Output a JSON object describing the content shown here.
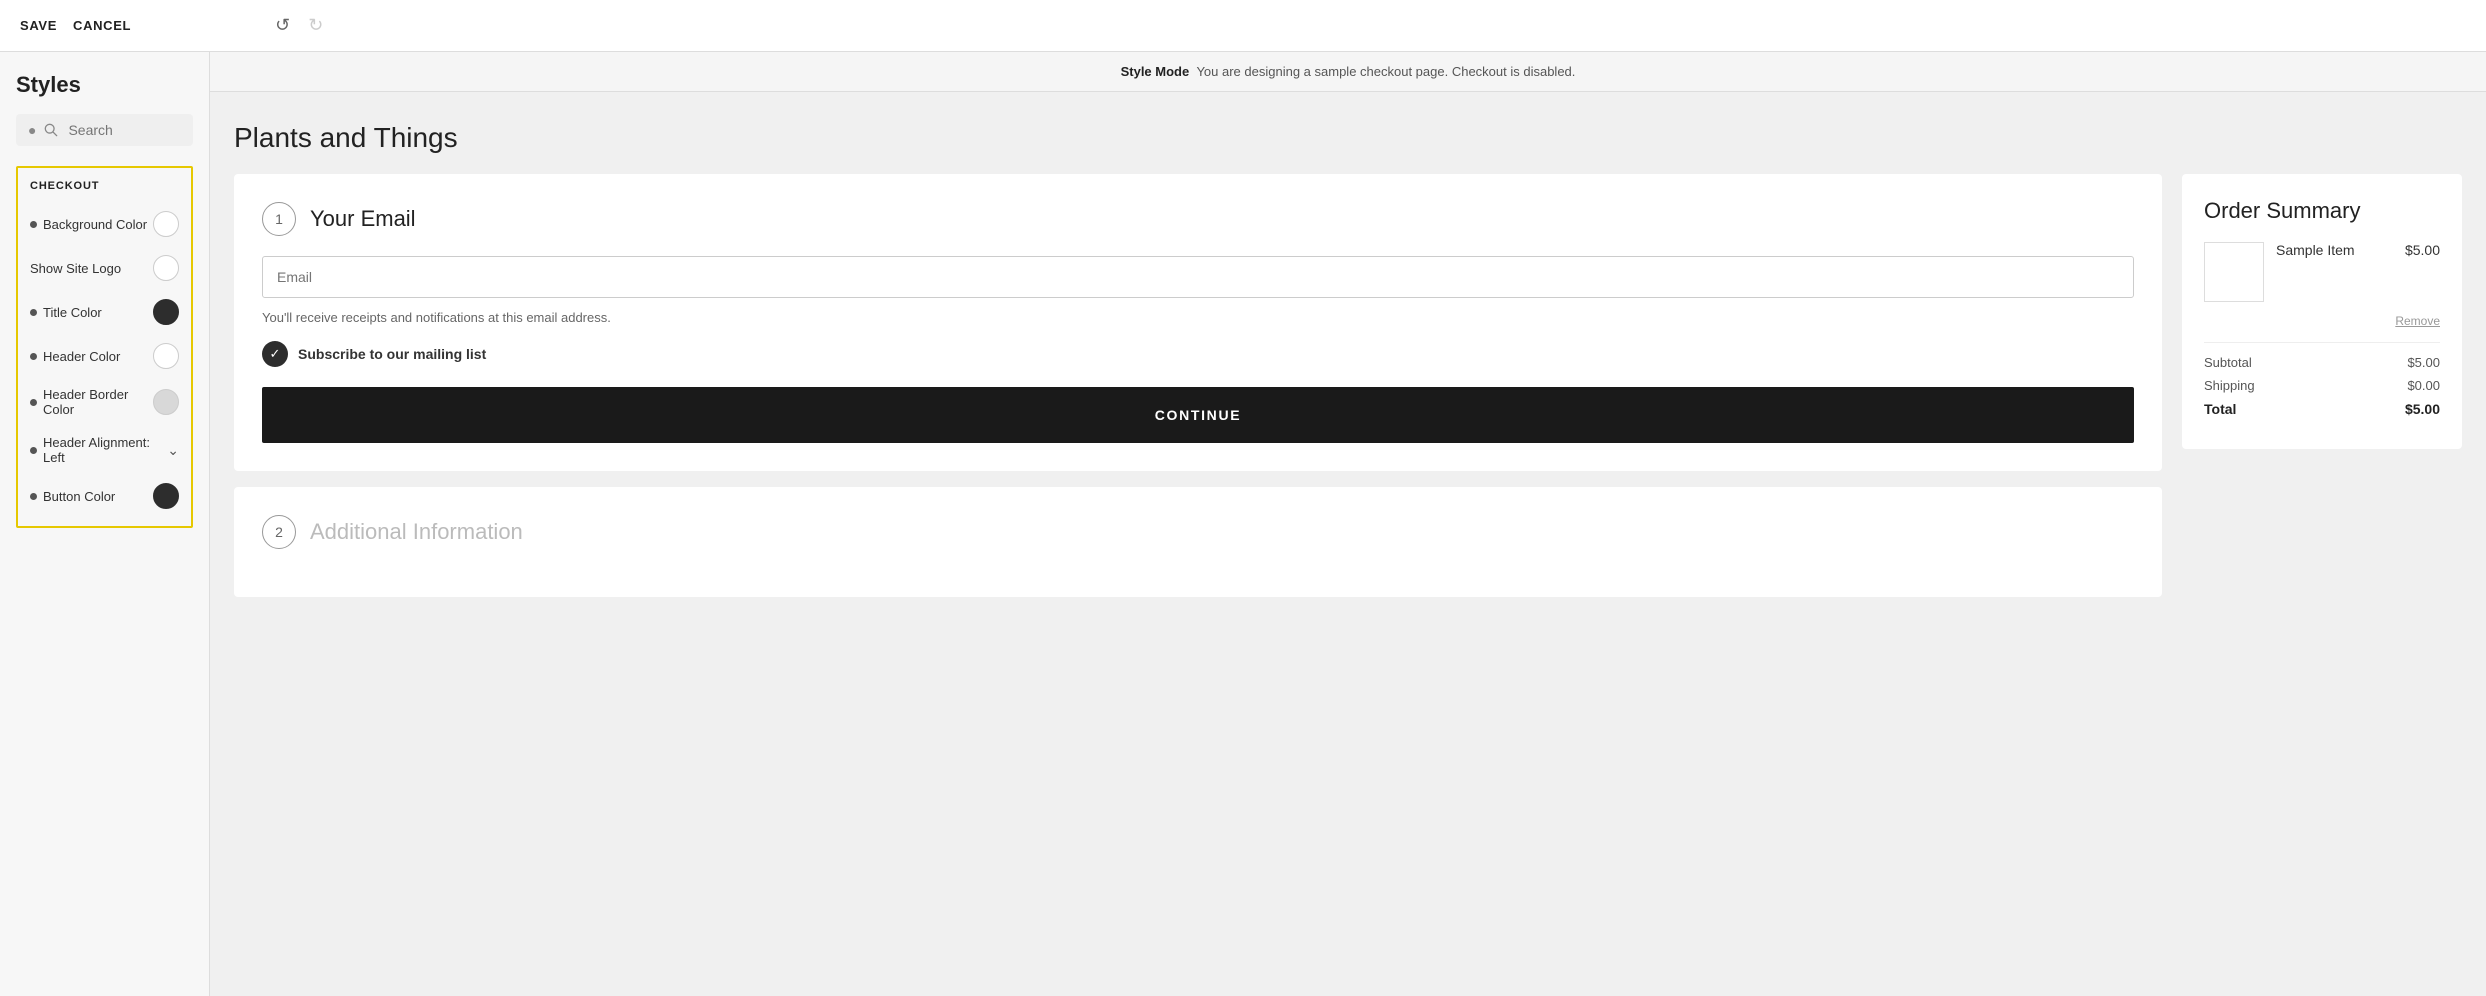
{
  "topbar": {
    "save_label": "SAVE",
    "cancel_label": "CANCEL",
    "undo_icon": "↺",
    "redo_icon": "↻"
  },
  "sidebar": {
    "title": "Styles",
    "search": {
      "placeholder": "Search"
    },
    "checkout_section": {
      "label": "CHECKOUT",
      "items": [
        {
          "id": "background-color",
          "label": "Background Color",
          "has_dot": true,
          "color_type": "empty"
        },
        {
          "id": "show-site-logo",
          "label": "Show Site Logo",
          "has_dot": false,
          "color_type": "empty"
        },
        {
          "id": "title-color",
          "label": "Title Color",
          "has_dot": true,
          "color_type": "dark"
        },
        {
          "id": "header-color",
          "label": "Header Color",
          "has_dot": true,
          "color_type": "empty"
        },
        {
          "id": "header-border-color",
          "label": "Header Border Color",
          "has_dot": true,
          "color_type": "light-gray"
        },
        {
          "id": "header-alignment",
          "label": "Header Alignment: Left",
          "has_dot": true,
          "control_type": "dropdown"
        },
        {
          "id": "button-color",
          "label": "Button Color",
          "has_dot": true,
          "color_type": "dark"
        }
      ]
    }
  },
  "banner": {
    "mode_label": "Style Mode",
    "message": "You are designing a sample checkout page. Checkout is disabled."
  },
  "page": {
    "title": "Plants and Things",
    "step1": {
      "number": "1",
      "title": "Your Email",
      "email_placeholder": "Email",
      "email_note": "You'll receive receipts and notifications at this email address.",
      "subscribe_label": "Subscribe to our mailing list",
      "continue_button": "CONTINUE"
    },
    "step2": {
      "number": "2",
      "title": "Additional Information"
    }
  },
  "order_summary": {
    "title": "Order Summary",
    "item_name": "Sample Item",
    "item_price": "$5.00",
    "remove_label": "Remove",
    "subtotal_label": "Subtotal",
    "subtotal_value": "$5.00",
    "shipping_label": "Shipping",
    "shipping_value": "$0.00",
    "total_label": "Total",
    "total_value": "$5.00"
  }
}
